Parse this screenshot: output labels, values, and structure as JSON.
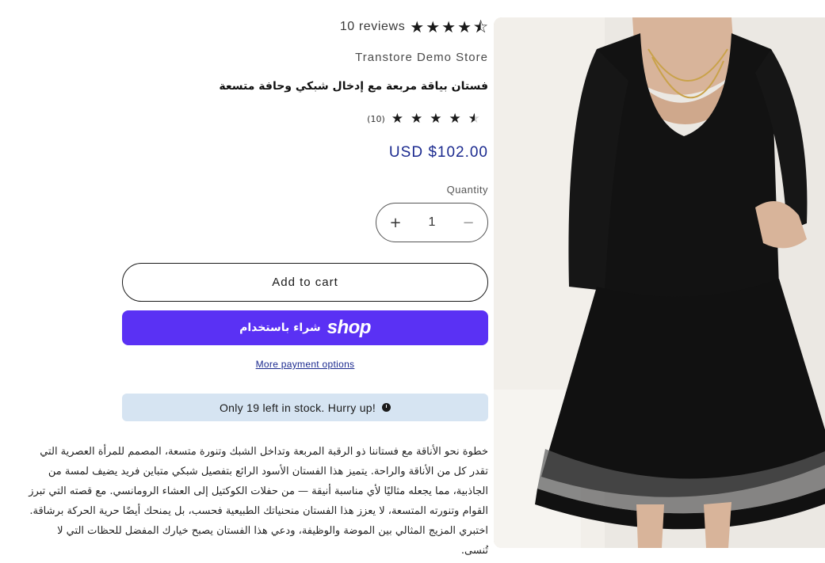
{
  "review_summary": {
    "stars": [
      "★",
      "★",
      "★",
      "★",
      "⯪"
    ],
    "count_text": "10 reviews"
  },
  "vendor": "Transtore Demo Store",
  "title": "فستان بياقة مربعة مع إدخال شبكي وحافة متسعة",
  "rating_small": {
    "count_text": "(10)",
    "stars": [
      "★",
      "★",
      "★",
      "★",
      "★"
    ]
  },
  "price": "USD $102.00",
  "quantity": {
    "label": "Quantity",
    "value": "1",
    "plus": "+",
    "minus": "−"
  },
  "add_to_cart_label": "Add to cart",
  "shop_pay": {
    "text": "شراء باستخدام",
    "logo": "shop"
  },
  "more_payment_options": "More payment options",
  "stock_banner": {
    "text": "!Only 19 left in stock. Hurry up"
  },
  "description": "خطوة نحو الأناقة مع فستاننا ذو الرقبة المربعة وتداخل الشبك وتنورة متسعة، المصمم للمرأة العصرية التي تقدر كل من الأناقة والراحة. يتميز هذا الفستان الأسود الرائع بتفصيل شبكي متباين فريد يضيف لمسة من الجاذبية، مما يجعله مثاليًا لأي مناسبة أنيقة — من حفلات الكوكتيل إلى العشاء الرومانسي. مع قصته التي تبرز القوام وتنورته المتسعة، لا يعزز هذا الفستان منحنياتك الطبيعية فحسب، بل يمنحك أيضًا حرية الحركة برشاقة. اختبري المزيج المثالي بين الموضة والوظيفة، ودعي هذا الفستان يصبح خيارك المفضل للحظات التي لا تُنسى.",
  "colors": {
    "accent": "#1b2a8f",
    "shop_pay": "#5a31f4",
    "stock_banner_bg": "#d6e4f2"
  }
}
